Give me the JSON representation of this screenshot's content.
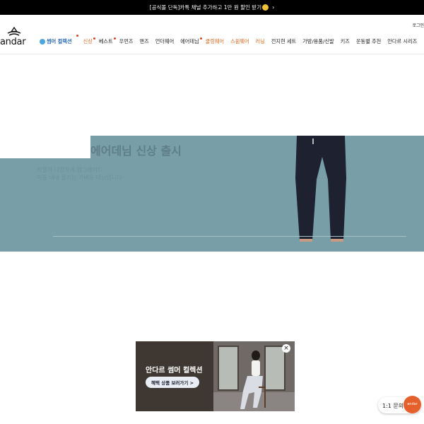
{
  "topbar": {
    "announcement": "[공식몰 단독]카톡 채널 추가하고 1만 원 할인 받기"
  },
  "header": {
    "login": "로그인",
    "logo_text": "andar",
    "nav": [
      {
        "label": "썸머 컬렉션",
        "dot": true
      },
      {
        "label": "신상",
        "dot": true
      },
      {
        "label": "베스트",
        "dot": true
      },
      {
        "label": "우먼즈",
        "dot": false
      },
      {
        "label": "맨즈",
        "dot": false
      },
      {
        "label": "언더웨어",
        "dot": false
      },
      {
        "label": "에어데님",
        "dot": true
      },
      {
        "label": "쿨링웨어",
        "dot": false
      },
      {
        "label": "스윔웨어",
        "dot": false
      },
      {
        "label": "러닝",
        "dot": false
      },
      {
        "label": "전지현 세트",
        "dot": false
      },
      {
        "label": "가방/용품/신발",
        "dot": false
      },
      {
        "label": "키즈",
        "dot": false
      },
      {
        "label": "운동별 추천",
        "dot": false
      },
      {
        "label": "안다르 시리즈",
        "dot": false
      }
    ]
  },
  "hero": {
    "title": "에어데님 신상 출시",
    "subtitle_line1": "카멜과 다양하게 업그레이드",
    "subtitle_line2": "여름 내내 즐기는 가벼운 데님입니다"
  },
  "popup": {
    "title": "안다르 썸머 컬렉션",
    "button": "혜택 상품 보러가기  >",
    "close": "×"
  },
  "chat": {
    "label": "1:1 문의",
    "badge": "andar"
  },
  "colors": {
    "accent": "#e06a1d",
    "summer": "#2b6bc4",
    "hero_bg": "#789fa8",
    "chat_badge": "#e5602a"
  }
}
